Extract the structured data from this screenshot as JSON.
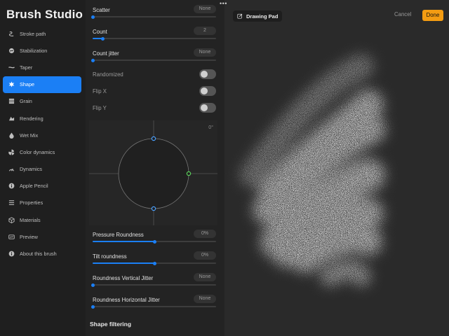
{
  "app": {
    "title": "Brush Studio"
  },
  "sidebar": {
    "items": [
      {
        "label": "Stroke path",
        "icon": "stroke-path-icon",
        "active": false
      },
      {
        "label": "Stabilization",
        "icon": "stabilization-icon",
        "active": false
      },
      {
        "label": "Taper",
        "icon": "taper-icon",
        "active": false
      },
      {
        "label": "Shape",
        "icon": "shape-icon",
        "active": true
      },
      {
        "label": "Grain",
        "icon": "grain-icon",
        "active": false
      },
      {
        "label": "Rendering",
        "icon": "rendering-icon",
        "active": false
      },
      {
        "label": "Wet Mix",
        "icon": "wet-mix-icon",
        "active": false
      },
      {
        "label": "Color dynamics",
        "icon": "color-dynamics-icon",
        "active": false
      },
      {
        "label": "Dynamics",
        "icon": "dynamics-icon",
        "active": false
      },
      {
        "label": "Apple Pencil",
        "icon": "apple-pencil-icon",
        "active": false
      },
      {
        "label": "Properties",
        "icon": "properties-icon",
        "active": false
      },
      {
        "label": "Materials",
        "icon": "materials-icon",
        "active": false
      },
      {
        "label": "Preview",
        "icon": "preview-icon",
        "active": false
      },
      {
        "label": "About this brush",
        "icon": "info-icon",
        "active": false
      }
    ]
  },
  "panel": {
    "scatter": {
      "label": "Scatter",
      "value": "None",
      "fraction": 0.0
    },
    "count": {
      "label": "Count",
      "value": "2",
      "fraction": 0.08
    },
    "count_jitter": {
      "label": "Count jitter",
      "value": "None",
      "fraction": 0.0
    },
    "randomized": {
      "label": "Randomized",
      "on": false
    },
    "flip_x": {
      "label": "Flip X",
      "on": false
    },
    "flip_y": {
      "label": "Flip Y",
      "on": false
    },
    "shape_editor": {
      "angle": "0°"
    },
    "pressure_roundness": {
      "label": "Pressure Roundness",
      "value": "0%",
      "fraction": 0.5
    },
    "tilt_roundness": {
      "label": "Tilt roundness",
      "value": "0%",
      "fraction": 0.5
    },
    "roundness_vertical_jitter": {
      "label": "Roundness Vertical Jitter",
      "value": "None",
      "fraction": 0.0
    },
    "roundness_horizontal_jitter": {
      "label": "Roundness Horizontal Jitter",
      "value": "None",
      "fraction": 0.0
    },
    "shape_filtering_title": "Shape filtering"
  },
  "canvas": {
    "pad_label": "Drawing Pad",
    "cancel_label": "Cancel",
    "done_label": "Done"
  },
  "colors": {
    "accent": "#1b7ff5",
    "done": "#f39c12",
    "editor_green": "#5ad25a"
  }
}
